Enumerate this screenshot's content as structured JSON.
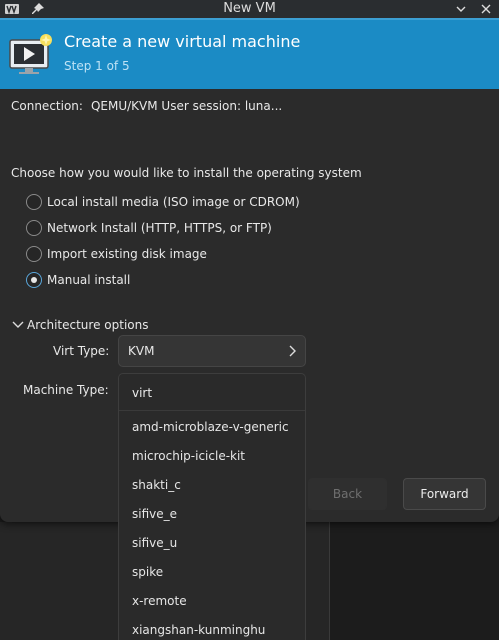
{
  "window": {
    "title": "New VM"
  },
  "header": {
    "title": "Create a new virtual machine",
    "step": "Step 1 of 5"
  },
  "connection": {
    "label": "Connection:",
    "value": "QEMU/KVM User session: luna..."
  },
  "install": {
    "prompt": "Choose how you would like to install the operating system",
    "options": [
      {
        "label": "Local install media (ISO image or CDROM)",
        "selected": false
      },
      {
        "label": "Network Install (HTTP, HTTPS, or FTP)",
        "selected": false
      },
      {
        "label": "Import existing disk image",
        "selected": false
      },
      {
        "label": "Manual install",
        "selected": true
      }
    ]
  },
  "architecture": {
    "expander_label": "Architecture options",
    "virt_type_label": "Virt Type:",
    "virt_type_value": "KVM",
    "machine_type_label": "Machine Type:"
  },
  "machine_dropdown": {
    "selected": "virt",
    "options": [
      "amd-microblaze-v-generic",
      "microchip-icicle-kit",
      "shakti_c",
      "sifive_e",
      "sifive_u",
      "spike",
      "x-remote",
      "xiangshan-kunminghu"
    ]
  },
  "buttons": {
    "back": "Back",
    "forward": "Forward"
  },
  "colors": {
    "header_bg": "#1b8bc5",
    "dialog_bg": "#2b2b2b",
    "radio_accent": "#5aa6da"
  }
}
